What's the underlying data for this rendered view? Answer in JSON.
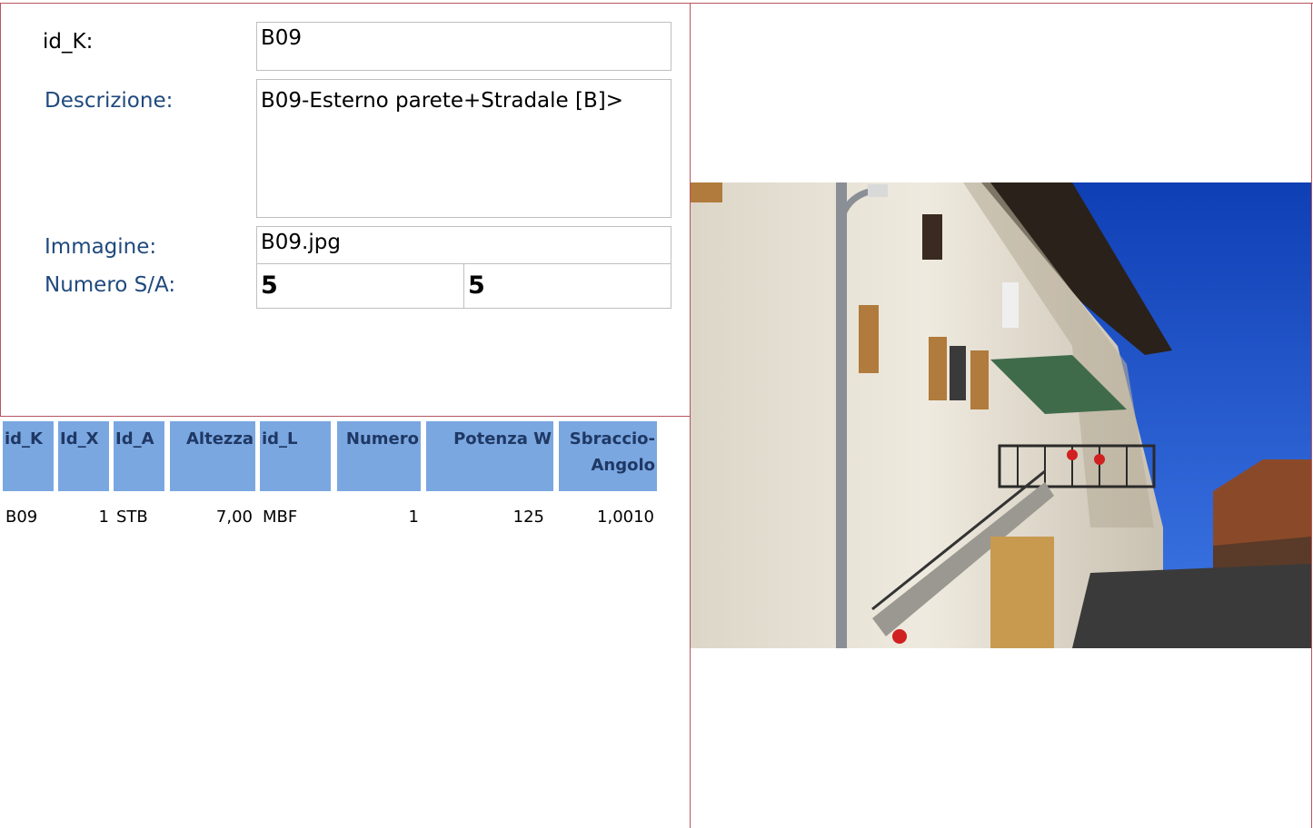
{
  "form": {
    "id_k_label": "id_K:",
    "id_k_value": "B09",
    "descrizione_label": "Descrizione:",
    "descrizione_value": "B09-Esterno parete+Stradale [B]>",
    "immagine_label": "Immagine:",
    "immagine_value": "B09.jpg",
    "numero_sa_label": "Numero S/A:",
    "numero_s": "5",
    "numero_a": "5"
  },
  "table": {
    "headers": [
      "id_K",
      "Id_X",
      "Id_A",
      "Altezza",
      "id_L",
      "Numero",
      "Potenza W",
      "Sbraccio-Angolo"
    ],
    "rows": [
      [
        "B09",
        "1",
        "STB",
        "7,00",
        "MBF",
        "1",
        "125",
        "1,0010"
      ]
    ]
  },
  "colors": {
    "header_bg": "#7ba7e1",
    "label_blue": "#1f497d",
    "border_red": "#b5565e"
  }
}
